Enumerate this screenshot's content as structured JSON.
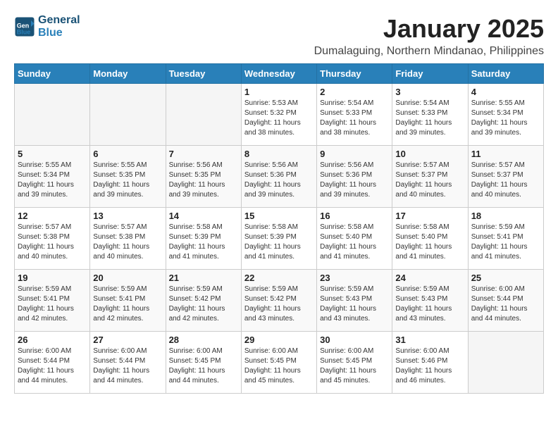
{
  "app": {
    "logo_line1": "General",
    "logo_line2": "Blue"
  },
  "header": {
    "month_title": "January 2025",
    "location": "Dumalaguing, Northern Mindanao, Philippines"
  },
  "weekdays": [
    "Sunday",
    "Monday",
    "Tuesday",
    "Wednesday",
    "Thursday",
    "Friday",
    "Saturday"
  ],
  "weeks": [
    [
      {
        "day": "",
        "sunrise": "",
        "sunset": "",
        "daylight": ""
      },
      {
        "day": "",
        "sunrise": "",
        "sunset": "",
        "daylight": ""
      },
      {
        "day": "",
        "sunrise": "",
        "sunset": "",
        "daylight": ""
      },
      {
        "day": "1",
        "sunrise": "Sunrise: 5:53 AM",
        "sunset": "Sunset: 5:32 PM",
        "daylight": "Daylight: 11 hours and 38 minutes."
      },
      {
        "day": "2",
        "sunrise": "Sunrise: 5:54 AM",
        "sunset": "Sunset: 5:33 PM",
        "daylight": "Daylight: 11 hours and 38 minutes."
      },
      {
        "day": "3",
        "sunrise": "Sunrise: 5:54 AM",
        "sunset": "Sunset: 5:33 PM",
        "daylight": "Daylight: 11 hours and 39 minutes."
      },
      {
        "day": "4",
        "sunrise": "Sunrise: 5:55 AM",
        "sunset": "Sunset: 5:34 PM",
        "daylight": "Daylight: 11 hours and 39 minutes."
      }
    ],
    [
      {
        "day": "5",
        "sunrise": "Sunrise: 5:55 AM",
        "sunset": "Sunset: 5:34 PM",
        "daylight": "Daylight: 11 hours and 39 minutes."
      },
      {
        "day": "6",
        "sunrise": "Sunrise: 5:55 AM",
        "sunset": "Sunset: 5:35 PM",
        "daylight": "Daylight: 11 hours and 39 minutes."
      },
      {
        "day": "7",
        "sunrise": "Sunrise: 5:56 AM",
        "sunset": "Sunset: 5:35 PM",
        "daylight": "Daylight: 11 hours and 39 minutes."
      },
      {
        "day": "8",
        "sunrise": "Sunrise: 5:56 AM",
        "sunset": "Sunset: 5:36 PM",
        "daylight": "Daylight: 11 hours and 39 minutes."
      },
      {
        "day": "9",
        "sunrise": "Sunrise: 5:56 AM",
        "sunset": "Sunset: 5:36 PM",
        "daylight": "Daylight: 11 hours and 39 minutes."
      },
      {
        "day": "10",
        "sunrise": "Sunrise: 5:57 AM",
        "sunset": "Sunset: 5:37 PM",
        "daylight": "Daylight: 11 hours and 40 minutes."
      },
      {
        "day": "11",
        "sunrise": "Sunrise: 5:57 AM",
        "sunset": "Sunset: 5:37 PM",
        "daylight": "Daylight: 11 hours and 40 minutes."
      }
    ],
    [
      {
        "day": "12",
        "sunrise": "Sunrise: 5:57 AM",
        "sunset": "Sunset: 5:38 PM",
        "daylight": "Daylight: 11 hours and 40 minutes."
      },
      {
        "day": "13",
        "sunrise": "Sunrise: 5:57 AM",
        "sunset": "Sunset: 5:38 PM",
        "daylight": "Daylight: 11 hours and 40 minutes."
      },
      {
        "day": "14",
        "sunrise": "Sunrise: 5:58 AM",
        "sunset": "Sunset: 5:39 PM",
        "daylight": "Daylight: 11 hours and 41 minutes."
      },
      {
        "day": "15",
        "sunrise": "Sunrise: 5:58 AM",
        "sunset": "Sunset: 5:39 PM",
        "daylight": "Daylight: 11 hours and 41 minutes."
      },
      {
        "day": "16",
        "sunrise": "Sunrise: 5:58 AM",
        "sunset": "Sunset: 5:40 PM",
        "daylight": "Daylight: 11 hours and 41 minutes."
      },
      {
        "day": "17",
        "sunrise": "Sunrise: 5:58 AM",
        "sunset": "Sunset: 5:40 PM",
        "daylight": "Daylight: 11 hours and 41 minutes."
      },
      {
        "day": "18",
        "sunrise": "Sunrise: 5:59 AM",
        "sunset": "Sunset: 5:41 PM",
        "daylight": "Daylight: 11 hours and 41 minutes."
      }
    ],
    [
      {
        "day": "19",
        "sunrise": "Sunrise: 5:59 AM",
        "sunset": "Sunset: 5:41 PM",
        "daylight": "Daylight: 11 hours and 42 minutes."
      },
      {
        "day": "20",
        "sunrise": "Sunrise: 5:59 AM",
        "sunset": "Sunset: 5:41 PM",
        "daylight": "Daylight: 11 hours and 42 minutes."
      },
      {
        "day": "21",
        "sunrise": "Sunrise: 5:59 AM",
        "sunset": "Sunset: 5:42 PM",
        "daylight": "Daylight: 11 hours and 42 minutes."
      },
      {
        "day": "22",
        "sunrise": "Sunrise: 5:59 AM",
        "sunset": "Sunset: 5:42 PM",
        "daylight": "Daylight: 11 hours and 43 minutes."
      },
      {
        "day": "23",
        "sunrise": "Sunrise: 5:59 AM",
        "sunset": "Sunset: 5:43 PM",
        "daylight": "Daylight: 11 hours and 43 minutes."
      },
      {
        "day": "24",
        "sunrise": "Sunrise: 5:59 AM",
        "sunset": "Sunset: 5:43 PM",
        "daylight": "Daylight: 11 hours and 43 minutes."
      },
      {
        "day": "25",
        "sunrise": "Sunrise: 6:00 AM",
        "sunset": "Sunset: 5:44 PM",
        "daylight": "Daylight: 11 hours and 44 minutes."
      }
    ],
    [
      {
        "day": "26",
        "sunrise": "Sunrise: 6:00 AM",
        "sunset": "Sunset: 5:44 PM",
        "daylight": "Daylight: 11 hours and 44 minutes."
      },
      {
        "day": "27",
        "sunrise": "Sunrise: 6:00 AM",
        "sunset": "Sunset: 5:44 PM",
        "daylight": "Daylight: 11 hours and 44 minutes."
      },
      {
        "day": "28",
        "sunrise": "Sunrise: 6:00 AM",
        "sunset": "Sunset: 5:45 PM",
        "daylight": "Daylight: 11 hours and 44 minutes."
      },
      {
        "day": "29",
        "sunrise": "Sunrise: 6:00 AM",
        "sunset": "Sunset: 5:45 PM",
        "daylight": "Daylight: 11 hours and 45 minutes."
      },
      {
        "day": "30",
        "sunrise": "Sunrise: 6:00 AM",
        "sunset": "Sunset: 5:45 PM",
        "daylight": "Daylight: 11 hours and 45 minutes."
      },
      {
        "day": "31",
        "sunrise": "Sunrise: 6:00 AM",
        "sunset": "Sunset: 5:46 PM",
        "daylight": "Daylight: 11 hours and 46 minutes."
      },
      {
        "day": "",
        "sunrise": "",
        "sunset": "",
        "daylight": ""
      }
    ]
  ]
}
